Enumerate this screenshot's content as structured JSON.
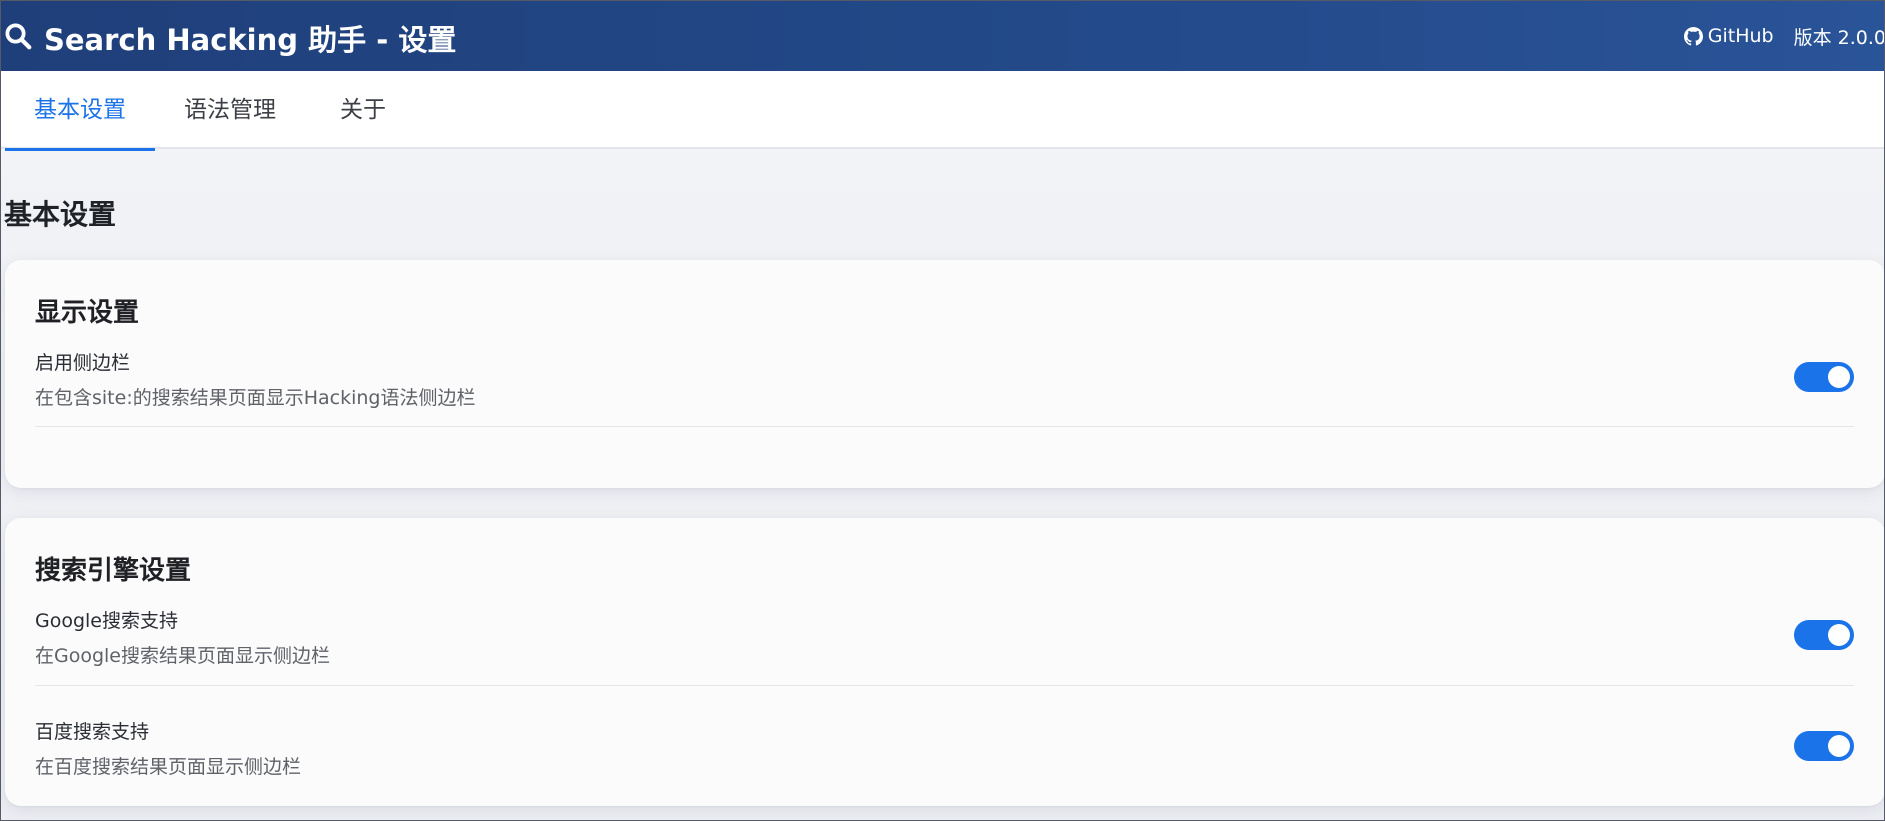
{
  "header": {
    "title": "Search Hacking 助手 - 设置",
    "github_label": "GitHub",
    "version_label": "版本 2.0.0"
  },
  "tabs": [
    {
      "label": "基本设置",
      "active": true
    },
    {
      "label": "语法管理",
      "active": false
    },
    {
      "label": "关于",
      "active": false
    }
  ],
  "page_title": "基本设置",
  "display_settings": {
    "title": "显示设置",
    "items": [
      {
        "label": "启用侧边栏",
        "description": "在包含site:的搜索结果页面显示Hacking语法侧边栏",
        "enabled": true
      }
    ]
  },
  "engine_settings": {
    "title": "搜索引擎设置",
    "items": [
      {
        "label": "Google搜索支持",
        "description": "在Google搜索结果页面显示侧边栏",
        "enabled": true
      },
      {
        "label": "百度搜索支持",
        "description": "在百度搜索结果页面显示侧边栏",
        "enabled": true
      }
    ]
  },
  "colors": {
    "header_bg": "#234a8a",
    "accent": "#1a73e8"
  },
  "icons": {
    "header_logo": "search-icon",
    "github": "github-icon"
  }
}
